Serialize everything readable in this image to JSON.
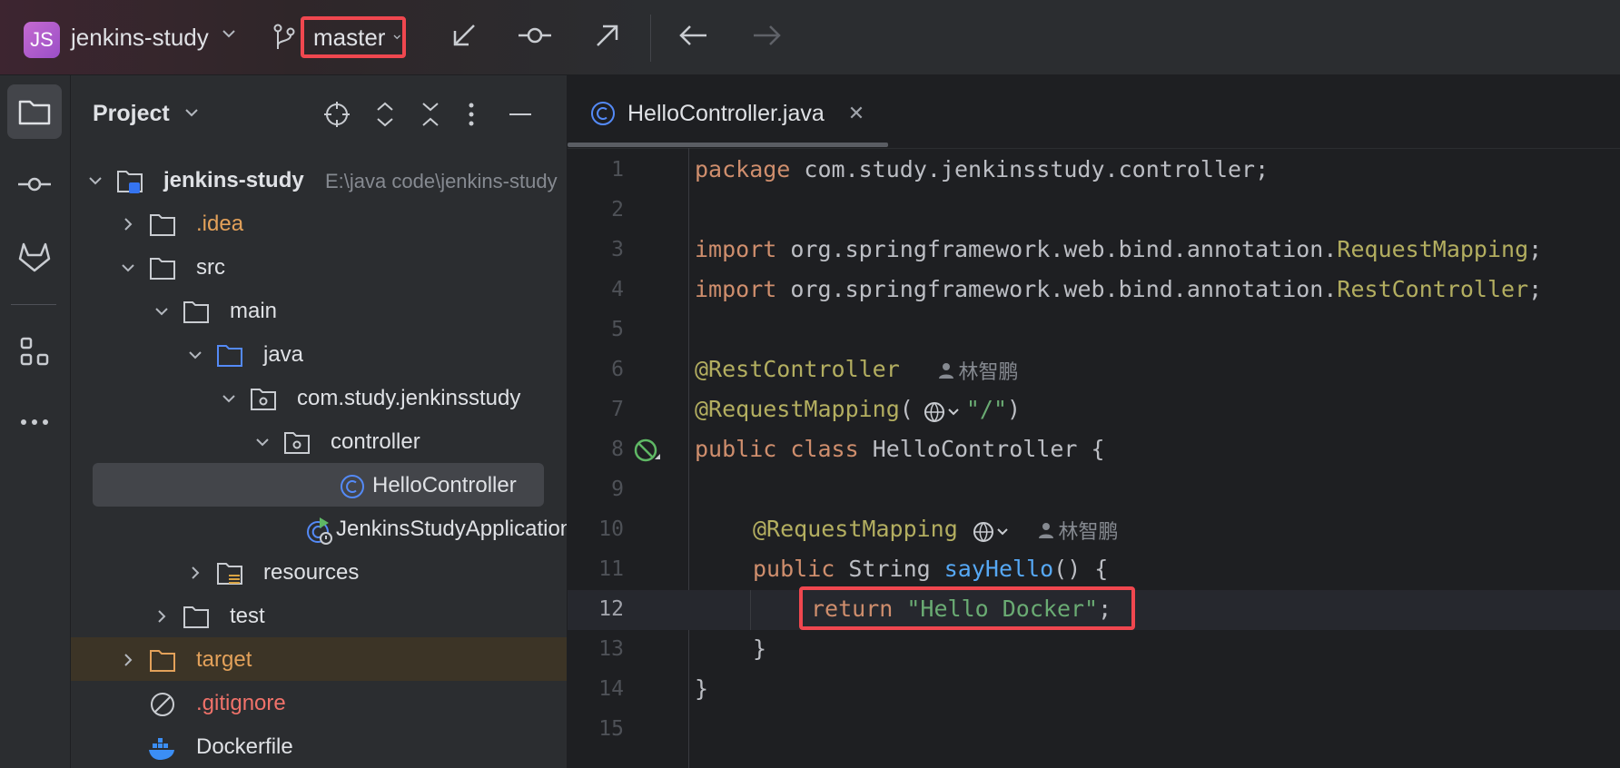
{
  "titlebar": {
    "project_initials": "JS",
    "project_name": "jenkins-study",
    "branch": "master"
  },
  "project_panel": {
    "title": "Project",
    "tree": [
      {
        "label": "jenkins-study",
        "path": "E:\\java code\\jenkins-study",
        "icon": "module-folder-icon"
      },
      {
        "label": ".idea",
        "icon": "folder-icon"
      },
      {
        "label": "src",
        "icon": "folder-icon"
      },
      {
        "label": "main",
        "icon": "folder-icon"
      },
      {
        "label": "java",
        "icon": "source-folder-icon"
      },
      {
        "label": "com.study.jenkinsstudy",
        "icon": "package-icon"
      },
      {
        "label": "controller",
        "icon": "package-icon"
      },
      {
        "label": "HelloController",
        "icon": "class-icon"
      },
      {
        "label": "JenkinsStudyApplication",
        "icon": "spring-boot-app-icon"
      },
      {
        "label": "resources",
        "icon": "resources-folder-icon"
      },
      {
        "label": "test",
        "icon": "folder-icon"
      },
      {
        "label": "target",
        "icon": "excluded-folder-icon"
      },
      {
        "label": ".gitignore",
        "icon": "ignore-file-icon"
      },
      {
        "label": "Dockerfile",
        "icon": "docker-icon"
      }
    ]
  },
  "editor": {
    "tab_label": "HelloController.java",
    "current_line": 12,
    "author_hint": "林智鹏",
    "lines": {
      "l1_kw": "package",
      "l1_rest": " com.study.jenkinsstudy.controller;",
      "l3_kw": "import",
      "l3_pkg": " org.springframework.web.bind.annotation.",
      "l3_cls": "RequestMapping",
      "l4_kw": "import",
      "l4_pkg": " org.springframework.web.bind.annotation.",
      "l4_cls": "RestController",
      "l6_ann": "@RestController",
      "l7_ann": "@RequestMapping",
      "l7_str": "\"/\"",
      "l8_kw1": "public",
      "l8_kw2": "class",
      "l8_rest": " HelloController {",
      "l10_ann": "@RequestMapping",
      "l11_kw": "public",
      "l11_type": " String ",
      "l11_fn": "sayHello",
      "l11_rest": "() {",
      "l12_kw": "return",
      "l12_str": "\"Hello Docker\"",
      "l13": "}",
      "l14": "}"
    },
    "line_numbers": [
      "1",
      "2",
      "3",
      "4",
      "5",
      "6",
      "7",
      "8",
      "9",
      "10",
      "11",
      "12",
      "13",
      "14",
      "15"
    ]
  }
}
